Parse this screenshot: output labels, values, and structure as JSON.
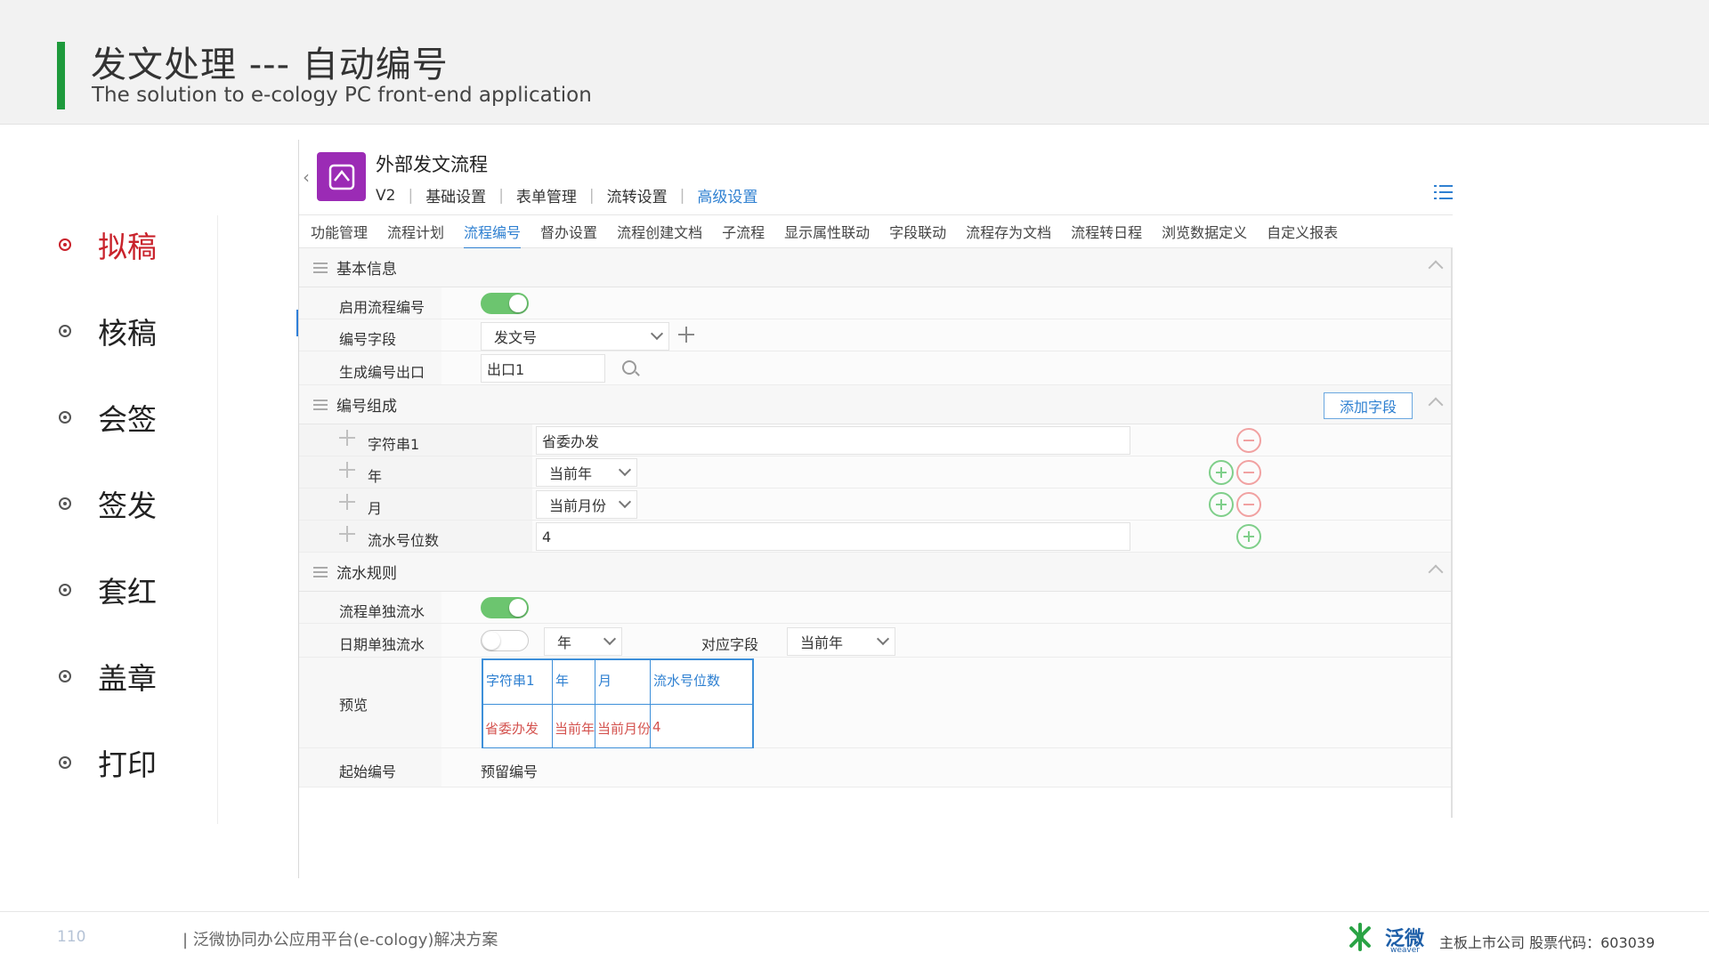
{
  "slide": {
    "title": "发文处理 --- 自动编号",
    "subtitle": "The solution to e-cology PC front-end application"
  },
  "steps": [
    {
      "label": "拟稿",
      "active": true
    },
    {
      "label": "核稿",
      "active": false
    },
    {
      "label": "会签",
      "active": false
    },
    {
      "label": "签发",
      "active": false
    },
    {
      "label": "套红",
      "active": false
    },
    {
      "label": "盖章",
      "active": false
    },
    {
      "label": "打印",
      "active": false
    }
  ],
  "app": {
    "title": "外部发文流程",
    "tabs": [
      "V2",
      "基础设置",
      "表单管理",
      "流转设置",
      "高级设置"
    ],
    "active_tab": "高级设置",
    "subnav": [
      "功能管理",
      "流程计划",
      "流程编号",
      "督办设置",
      "流程创建文档",
      "子流程",
      "显示属性联动",
      "字段联动",
      "流程存为文档",
      "流程转日程",
      "浏览数据定义",
      "自定义报表"
    ],
    "active_subnav": "流程编号",
    "basic": {
      "header": "基本信息",
      "enable_label": "启用流程编号",
      "field_label": "编号字段",
      "field_value": "发文号",
      "exit_label": "生成编号出口",
      "exit_value": "出口1"
    },
    "composition": {
      "header": "编号组成",
      "add_button": "添加字段",
      "rows": [
        {
          "label": "字符串1",
          "value": "省委办发"
        },
        {
          "label": "年",
          "value": "当前年"
        },
        {
          "label": "月",
          "value": "当前月份"
        },
        {
          "label": "流水号位数",
          "value": "4"
        }
      ]
    },
    "serial": {
      "header": "流水规则",
      "independent_label": "流程单独流水",
      "date_label": "日期单独流水",
      "date_value": "年",
      "mapping_label": "对应字段",
      "mapping_value": "当前年",
      "preview_label": "预览",
      "preview_headers": [
        "字符串1",
        "年",
        "月",
        "流水号位数"
      ],
      "preview_values": [
        "省委办发",
        "当前年",
        "当前月份",
        "4"
      ],
      "start_label": "起始编号",
      "start_value": "预留编号"
    }
  },
  "footer": {
    "page_number": "110",
    "text": "| 泛微协同办公应用平台(e-cology)解决方案",
    "brand_name": "泛微",
    "brand_en": "weaver",
    "company": "主板上市公司    股票代码：603039"
  },
  "colors": {
    "accent_green": "#1e9a3c",
    "active_red": "#c9222b",
    "link_blue": "#2f80d1"
  }
}
